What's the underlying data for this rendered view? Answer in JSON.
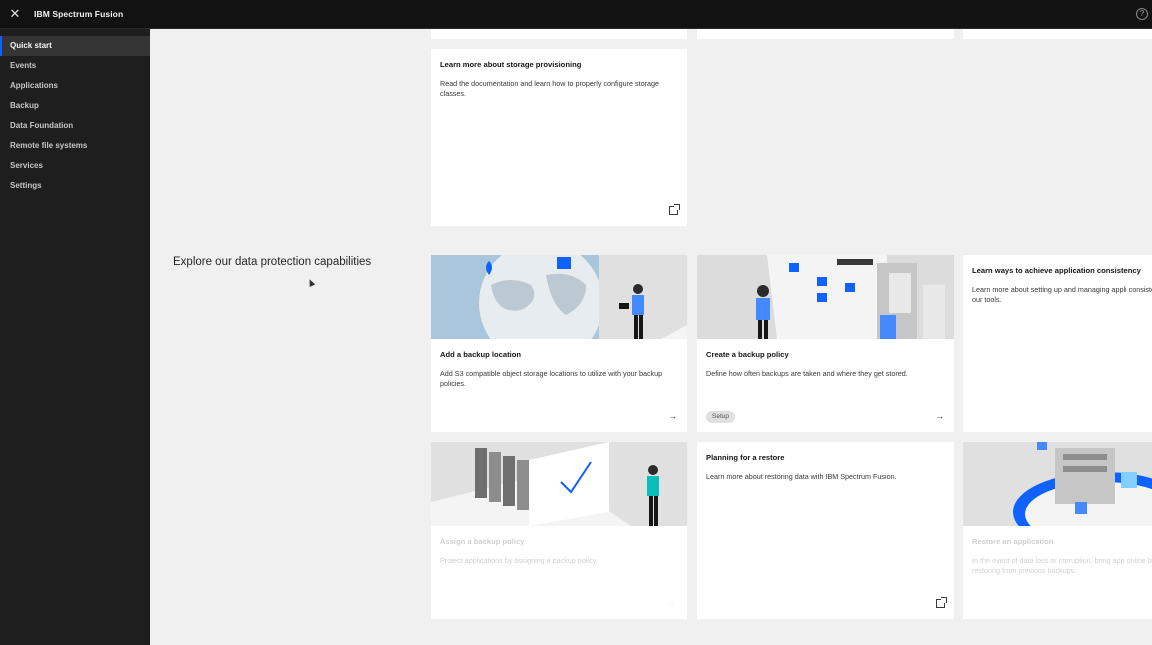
{
  "app": {
    "title": "IBM Spectrum Fusion"
  },
  "sidebar": {
    "items": [
      {
        "label": "Quick start",
        "active": true
      },
      {
        "label": "Events"
      },
      {
        "label": "Applications"
      },
      {
        "label": "Backup"
      },
      {
        "label": "Data Foundation"
      },
      {
        "label": "Remote file systems"
      },
      {
        "label": "Services"
      },
      {
        "label": "Settings"
      }
    ]
  },
  "main": {
    "section_title": "Explore our data protection capabilities",
    "cards": {
      "storage": {
        "title": "Learn more about storage provisioning",
        "desc": "Read the documentation and learn how to properly configure storage classes."
      },
      "backup_location": {
        "title": "Add a backup location",
        "desc": "Add S3 compatible object storage locations to utilize with your backup policies."
      },
      "backup_policy": {
        "title": "Create a backup policy",
        "desc": "Define how often backups are taken and where they get stored.",
        "tag": "Setup"
      },
      "consistency": {
        "title": "Learn ways to achieve application consistency",
        "desc": "Learn more about setting up and managing appli consistency with our tools."
      },
      "assign_policy": {
        "title": "Assign a backup policy",
        "desc": "Protect applications by assigning a backup policy."
      },
      "restore_planning": {
        "title": "Planning for a restore",
        "desc": "Learn more about restoring data with IBM Spectrum Fusion."
      },
      "restore_app": {
        "title": "Restore an application",
        "desc": "In the event of data loss or corruption, bring app online by restoring from previous backups."
      }
    }
  },
  "colors": {
    "accent": "#0f62fe",
    "sidebar_bg": "#1e1e1e",
    "content_bg": "#f0f0f0"
  }
}
